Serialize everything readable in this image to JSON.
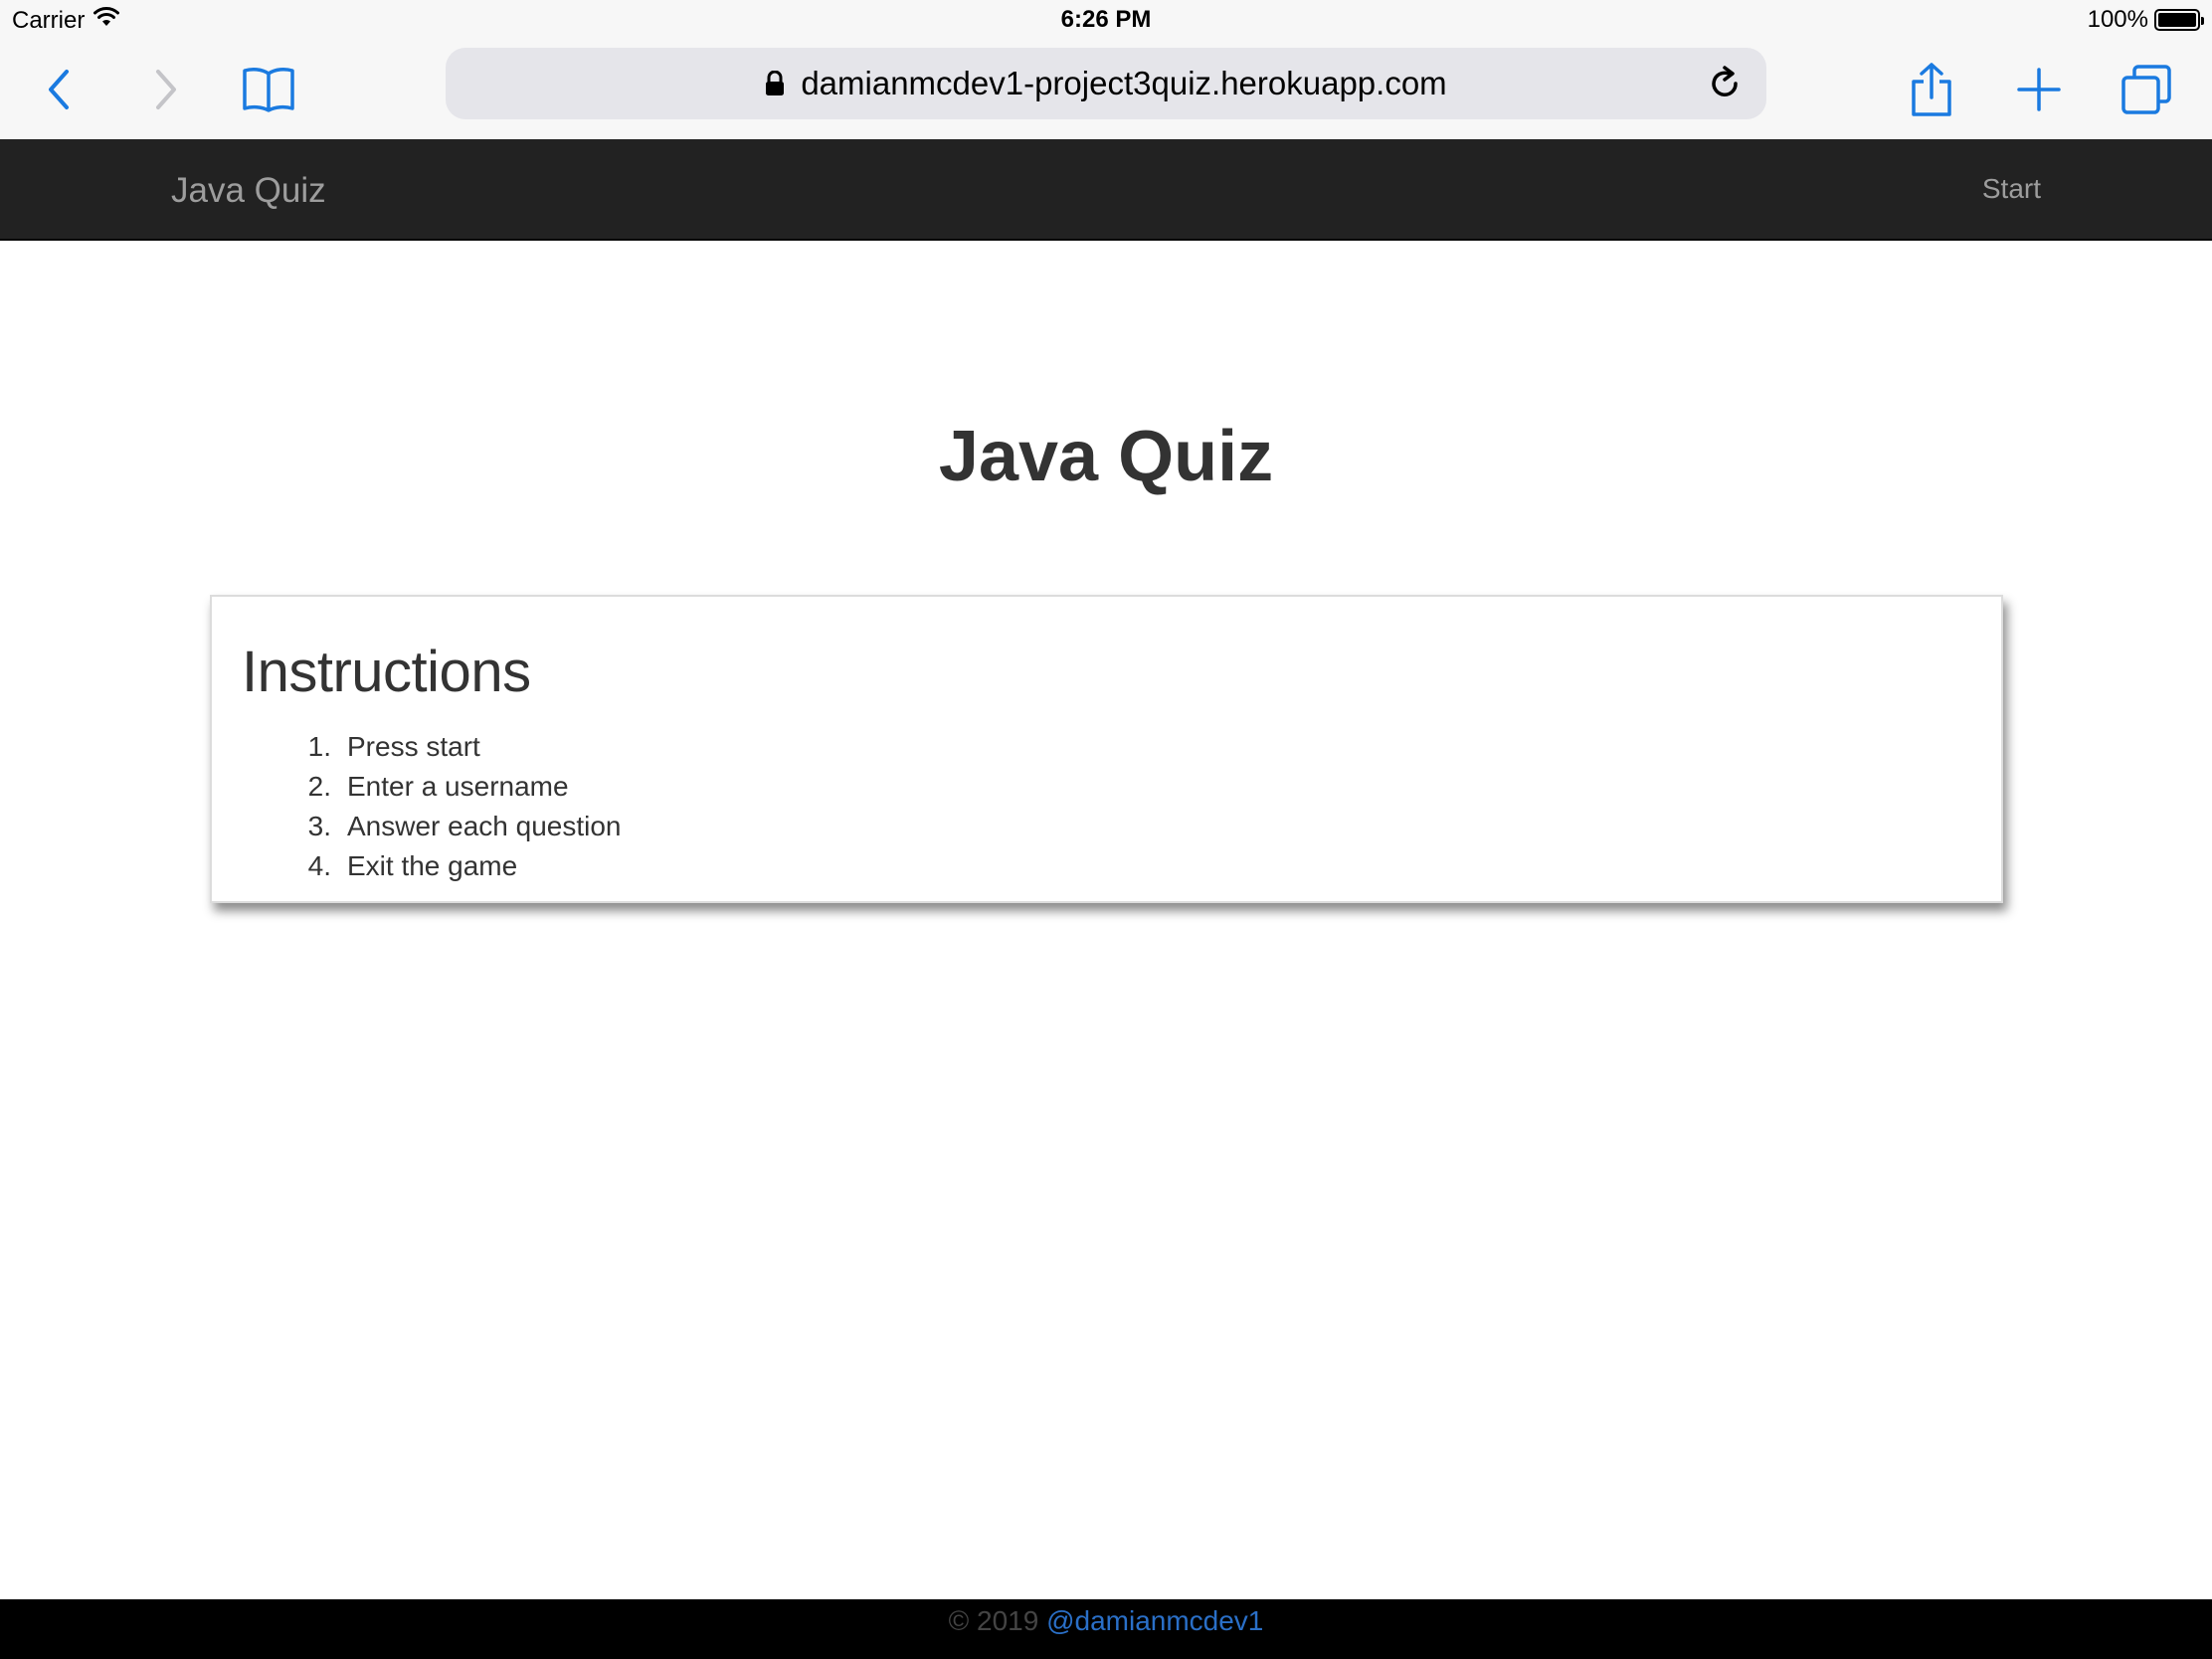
{
  "status_bar": {
    "carrier": "Carrier",
    "time": "6:26 PM",
    "battery": "100%"
  },
  "browser": {
    "url": "damianmcdev1-project3quiz.herokuapp.com",
    "accent": "#1a7ae0"
  },
  "navbar": {
    "brand": "Java Quiz",
    "start": "Start"
  },
  "main": {
    "title": "Java Quiz",
    "panel_heading": "Instructions",
    "steps": [
      {
        "num": "1.",
        "text": "Press start"
      },
      {
        "num": "2.",
        "text": "Enter a username"
      },
      {
        "num": "3.",
        "text": "Answer each question"
      },
      {
        "num": "4.",
        "text": "Exit the game"
      }
    ]
  },
  "footer": {
    "copyright": "© 2019",
    "handle": "@damianmcdev1"
  }
}
